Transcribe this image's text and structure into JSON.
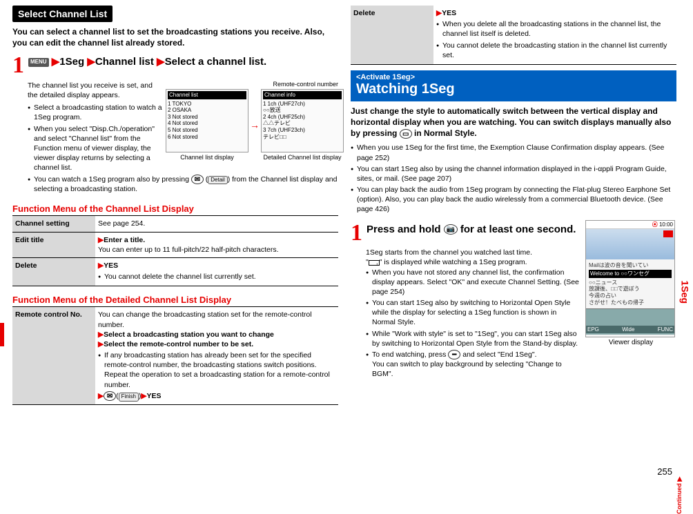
{
  "page_number": "255",
  "side_label": "1Seg",
  "continued": "Continued",
  "left": {
    "title": "Select Channel List",
    "intro": "You can select a channel list to set the broadcasting stations you receive. Also, you can edit the channel list already stored.",
    "step_num": "1",
    "menu_icon": "MENU",
    "step_seg1": "1Seg",
    "step_seg2": "Channel list",
    "step_seg3": "Select a channel list.",
    "body1": "The channel list you receive is set, and the detailed display appears.",
    "bullets1": [
      "Select a broadcasting station to watch a 1Seg program.",
      "When you select \"Disp.Ch./operation\" and select \"Channel list\" from the Function menu of viewer display, the viewer display returns by selecting a channel list.",
      "You can watch a 1Seg program also by pressing "
    ],
    "bullets1_tail_btn": "Detail",
    "bullets1_tail": " from the Channel list display and selecting a broadcasting station.",
    "img_remote_label": "Remote-control number",
    "img_list_caption": "Channel list display",
    "img_detail_caption": "Detailed Channel list display",
    "img_list_header": "Channel list",
    "img_list_lines": [
      "1 TOKYO",
      "2 OSAKA",
      "3 Not stored",
      "4 Not stored",
      "5 Not stored",
      "6 Not stored"
    ],
    "img_detail_header": "Channel info",
    "img_detail_lines": [
      "1  1ch (UHF27ch)",
      "   ○○放送",
      "2  4ch (UHF25ch)",
      "   △△テレビ",
      "3  7ch (UHF23ch)",
      "   テレビ□□"
    ],
    "fnhead1": "Function Menu of the Channel List Display",
    "t1r1h": "Channel setting",
    "t1r1": "See page 254.",
    "t1r2h": "Edit title",
    "t1r2a": "Enter a title.",
    "t1r2b": "You can enter up to 11 full-pitch/22 half-pitch characters.",
    "t1r3h": "Delete",
    "t1r3a": "YES",
    "t1r3b": "You cannot delete the channel list currently set.",
    "fnhead2": "Function Menu of the Detailed Channel List Display",
    "t2r1h": "Remote control No.",
    "t2r1a": "You can change the broadcasting station set for the remote-control number.",
    "t2r1b": "Select a broadcasting station you want to change",
    "t2r1c": "Select the remote-control number to be set.",
    "t2r1d": "If any broadcasting station has already been set for the specified remote-control number, the broadcasting stations switch positions. Repeat the operation to set a broadcasting station for a remote-control number.",
    "t2r1e_btn": "Finish",
    "t2r1e": "YES"
  },
  "right": {
    "t3r1h": "Delete",
    "t3r1a": "YES",
    "t3r1b": "When you delete all the broadcasting stations in the channel list, the channel list itself is deleted.",
    "t3r1c": "You cannot delete the broadcasting station in the channel list currently set.",
    "bluesmall": "<Activate 1Seg>",
    "bluebig": "Watching 1Seg",
    "intro": "Just change the style to automatically switch between the vertical display and horizontal display when you are watching. You can switch displays manually also by pressing ",
    "intro_tail": " in Normal Style.",
    "bullets": [
      "When you use 1Seg for the first time, the Exemption Clause Confirmation display appears. (See page 252)",
      "You can start 1Seg also by using the channel information displayed in the i-αppli Program Guide, sites, or mail. (See page 207)",
      "You can play back the audio from 1Seg program by connecting the Flat-plug Stereo Earphone Set (option). Also, you can play back the audio wirelessly from a commercial Bluetooth device. (See page 426)"
    ],
    "step_num": "1",
    "step_text_a": "Press and hold ",
    "step_text_b": " for at least one second.",
    "body_after_step": "1Seg starts from the channel you watched last time.",
    "body_icon_line_a": "\"",
    "body_icon_line_b": "\" is displayed while watching a 1Seg program.",
    "step_bullets": [
      "When you have not stored any channel list, the confirmation display appears. Select \"OK\" and execute Channel Setting. (See page 254)",
      "You can start 1Seg also by switching to Horizontal Open Style while the display for selecting a 1Seg function is shown in Normal Style.",
      "While \"Work with style\" is set to \"1Seg\", you can start 1Seg also by switching to Horizontal Open Style from the Stand-by display.",
      "To end watching, press "
    ],
    "step_bullet_tail_a": " and select \"End 1Seg\".",
    "step_bullet_tail_b": "You can switch to play background by selecting \"Change to BGM\".",
    "viewer_caption": "Viewer display",
    "viewer_time": "10:00",
    "viewer_text1": "Mailは波の音を聞いてい",
    "viewer_text2": "Welcome to ○○ワンセグ",
    "viewer_text3": "○○ニュース",
    "viewer_text4": "放課後、□□で遊ぼう",
    "viewer_text5": "今週の占い",
    "viewer_text6": "さがせ！たべもの帰子",
    "sk1": "EPG",
    "sk2": "Wide",
    "sk3": "FUNC"
  }
}
